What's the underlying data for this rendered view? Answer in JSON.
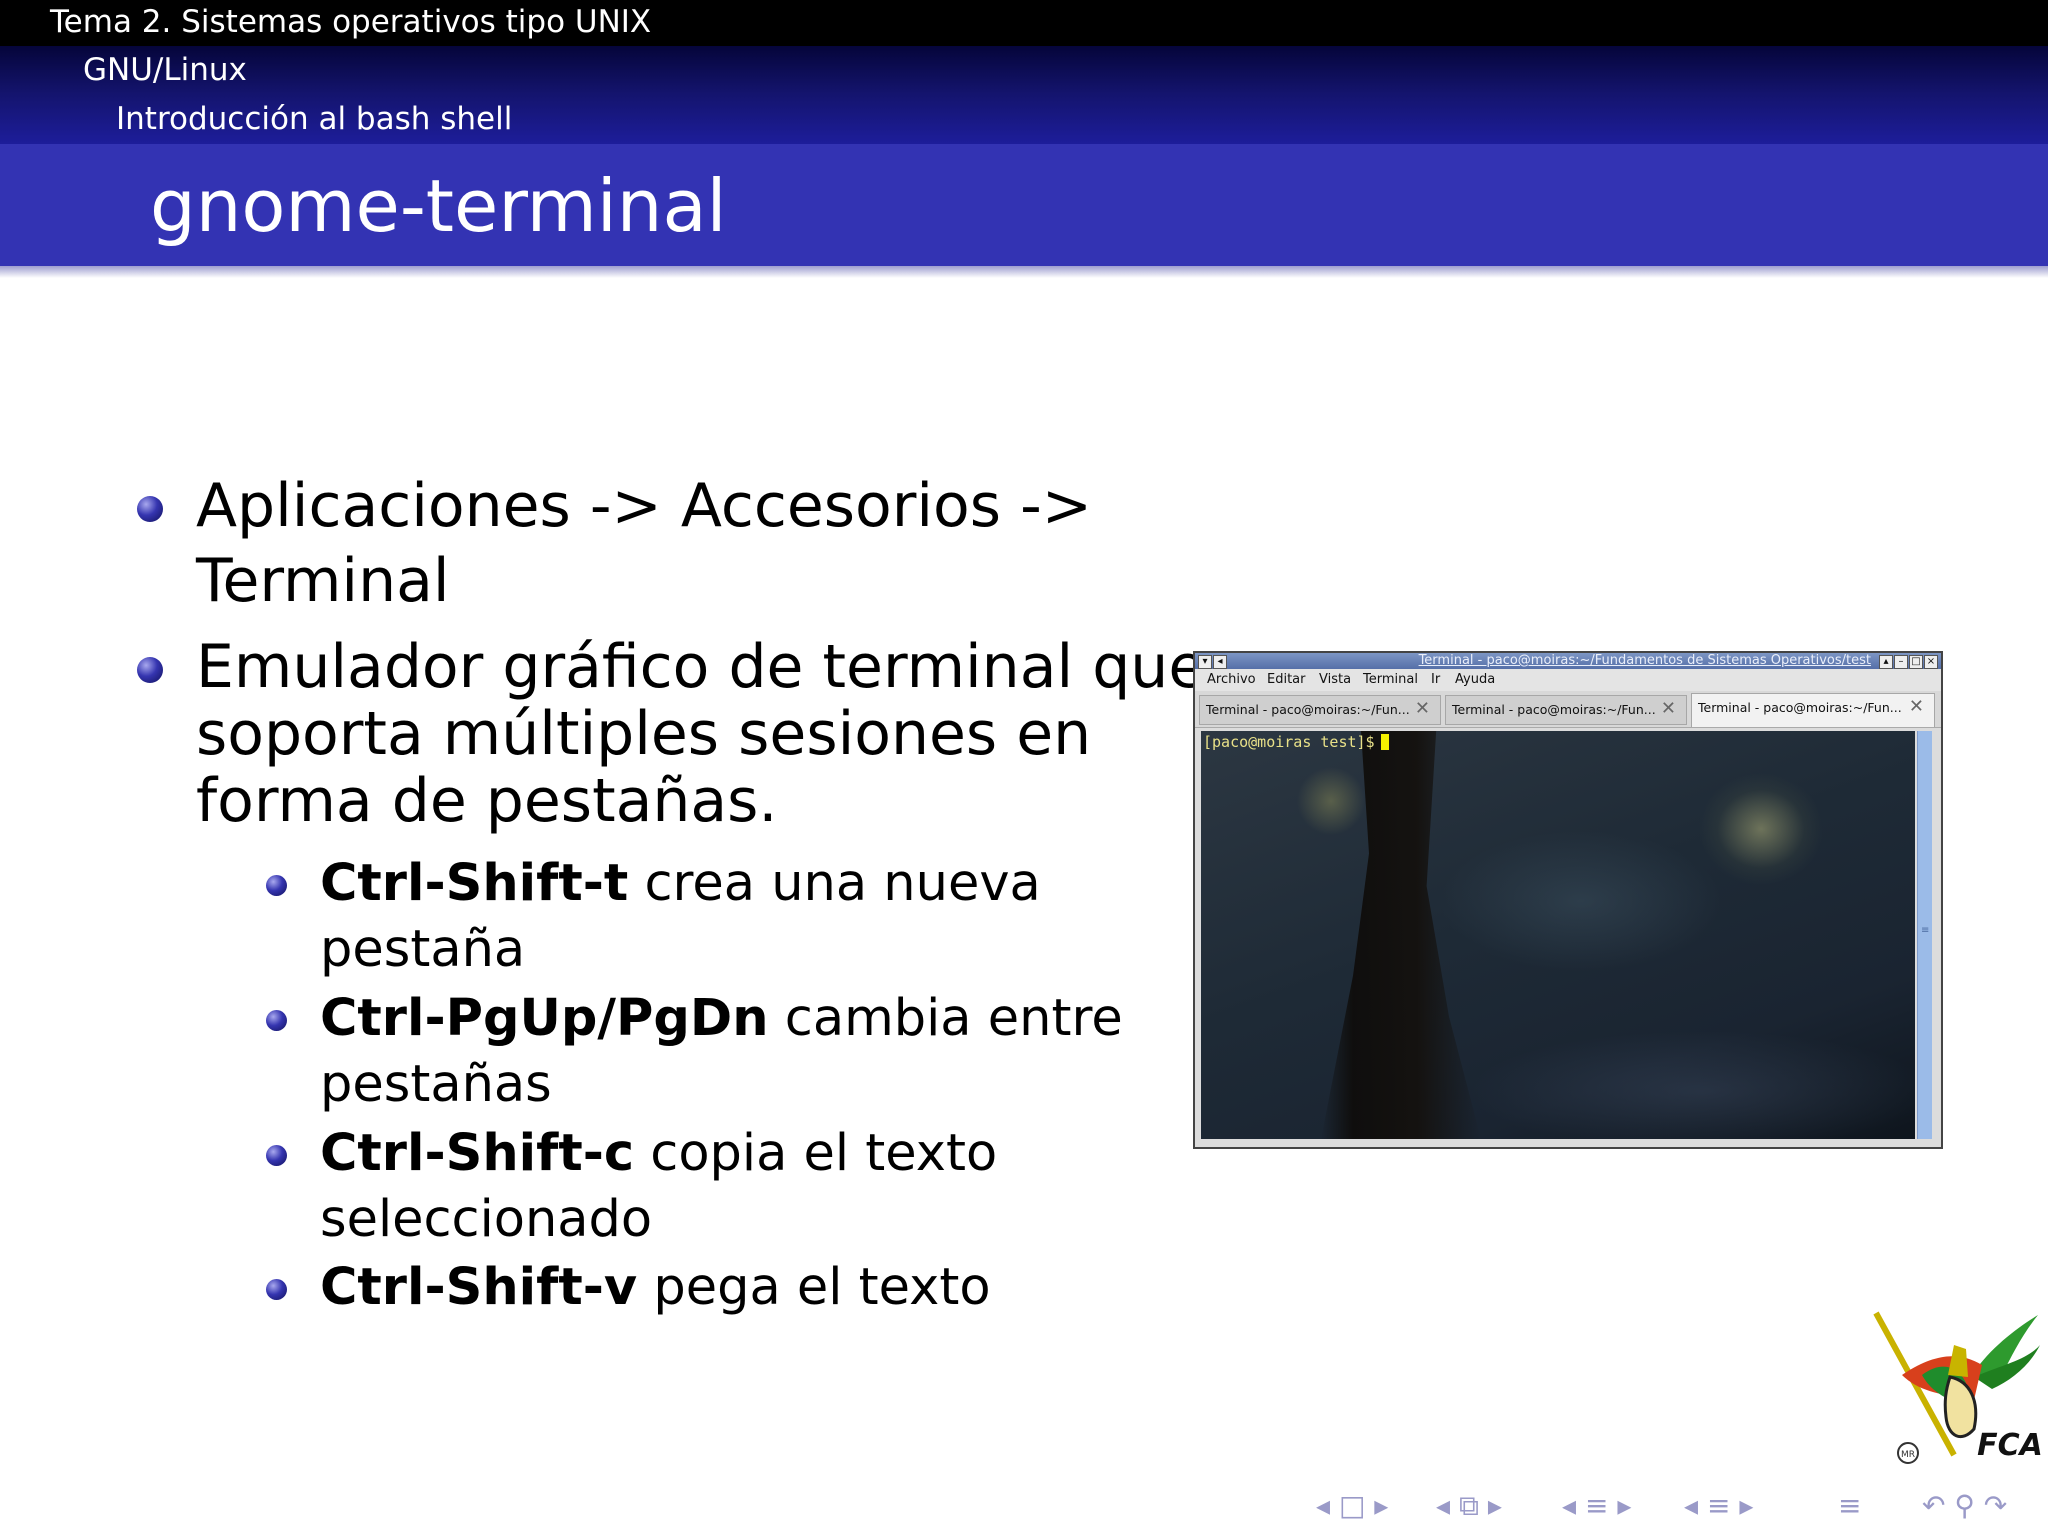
{
  "header": {
    "section": "Tema 2. Sistemas operativos tipo UNIX",
    "subsection": "GNU/Linux",
    "subsubsection": "Introducción al bash shell"
  },
  "frame_title": "gnome-terminal",
  "bullets": [
    {
      "line1": "Aplicaciones -> Accesorios ->",
      "line2": "Terminal"
    },
    {
      "line1": "Emulador gráfico de terminal que",
      "line2": "soporta múltiples sesiones en",
      "line3": "forma de pestañas."
    }
  ],
  "subbullets": [
    {
      "key": "Ctrl-Shift-t",
      "rest": " crea una nueva",
      "line2": "pestaña"
    },
    {
      "key": "Ctrl-PgUp/PgDn",
      "rest": " cambia entre",
      "line2": "pestañas"
    },
    {
      "key": "Ctrl-Shift-c",
      "rest": " copia el texto",
      "line2": "seleccionado"
    },
    {
      "key": "Ctrl-Shift-v",
      "rest": " pega el texto"
    }
  ],
  "terminal": {
    "window_title": "Terminal - paco@moiras:~/Fundamentos de Sistemas Operativos/test",
    "menu": [
      "Archivo",
      "Editar",
      "Vista",
      "Terminal",
      "Ir",
      "Ayuda"
    ],
    "tabs": [
      "Terminal - paco@moiras:~/Fun...",
      "Terminal - paco@moiras:~/Fun...",
      "Terminal - paco@moiras:~/Fun..."
    ],
    "active_tab_index": 2,
    "prompt": "[paco@moiras test]$"
  },
  "logo": {
    "text": "FCA",
    "mark": "MR"
  },
  "nav_symbols": {
    "frame": "◂ □ ▸",
    "subsection": "◂ ⧉ ▸",
    "section1": "◂ ≡ ▸",
    "section2": "◂ ≡ ▸",
    "toc": "≡",
    "search": "↶ ⚲ ↷"
  },
  "colors": {
    "title_bar": "#3333b3",
    "bullet": "#3535b0",
    "header_top": "#000000"
  }
}
